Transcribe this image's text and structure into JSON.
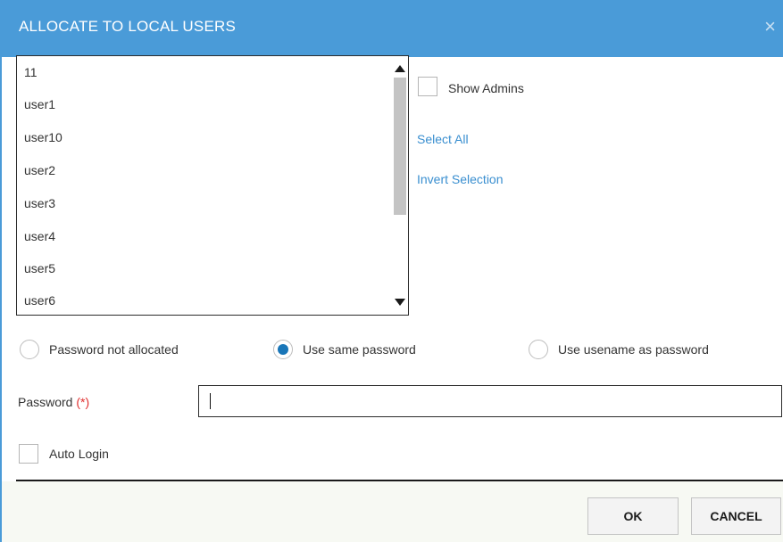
{
  "dialog": {
    "title": "ALLOCATE TO LOCAL USERS",
    "close_glyph": "×"
  },
  "user_list": {
    "items": [
      "11",
      "user1",
      "user10",
      "user2",
      "user3",
      "user4",
      "user5",
      "user6"
    ]
  },
  "options": {
    "show_admins_label": "Show Admins",
    "show_admins_checked": false,
    "select_all_label": "Select All",
    "invert_selection_label": "Invert Selection"
  },
  "password_mode": {
    "options": [
      {
        "label": "Password not allocated",
        "selected": false
      },
      {
        "label": "Use same password",
        "selected": true
      },
      {
        "label": "Use usename as password",
        "selected": false
      }
    ]
  },
  "password_field": {
    "label": "Password",
    "required_marker": "(*)",
    "value": ""
  },
  "auto_login": {
    "label": "Auto Login",
    "checked": false
  },
  "buttons": {
    "ok_label": "OK",
    "cancel_label": "CANCEL"
  },
  "colors": {
    "title_bar": "#4a9bd8",
    "link": "#3a8fd0",
    "radio_selected": "#1976b8",
    "required": "#e03030"
  }
}
